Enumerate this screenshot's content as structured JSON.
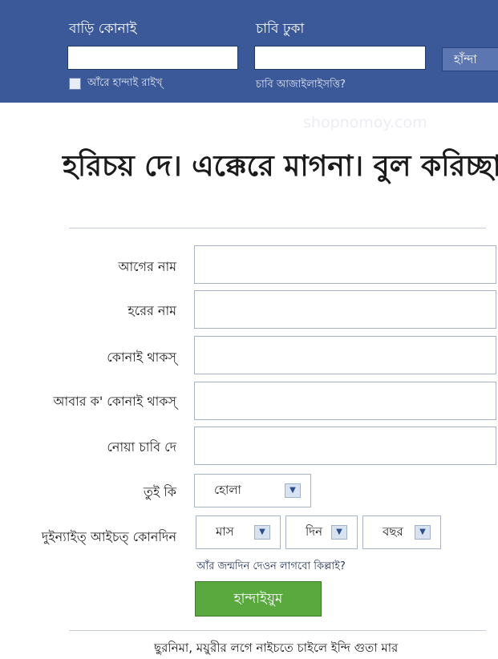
{
  "login": {
    "email_label": "বাড়ি কোনাই",
    "password_label": "চাবি ঢুকা",
    "login_button": "হাঁন্দা",
    "remember_label": "আঁরে হান্দাই রাইখ্",
    "forgot_link": "চাবি আজাইলাইসত্তি?"
  },
  "watermark": "shopnomoy.com",
  "heading": "হরিচয় দে। এক্কেরে মাগনা। বুল করিচ্ছা",
  "form": {
    "first_name_label": "আগের নাম",
    "last_name_label": "হরের নাম",
    "email_label": "কোনাই থাকস্",
    "email_confirm_label": "আবার ক' কোনাই থাকস্",
    "password_label": "নোয়া চাবি দে",
    "gender_label": "তুই কি",
    "gender_value": "হোলা",
    "birthday_label": "দুইন্যাইত্ আইচত্ কোনদিন",
    "month_value": "মাস",
    "day_value": "দিন",
    "year_value": "বছর",
    "why_birthday_link": "আঁর জন্মদিন দেওন লাগবো কিল্লাই?",
    "signup_button": "হান্দাইয়ুম"
  },
  "footer_text": "ছুরনিমা, ময়ুরীর লগে নাইচতে চাইলে ইন্দি গুতা মার",
  "colors": {
    "top_bar": "#3b5998",
    "signup_button": "#59a93f"
  }
}
